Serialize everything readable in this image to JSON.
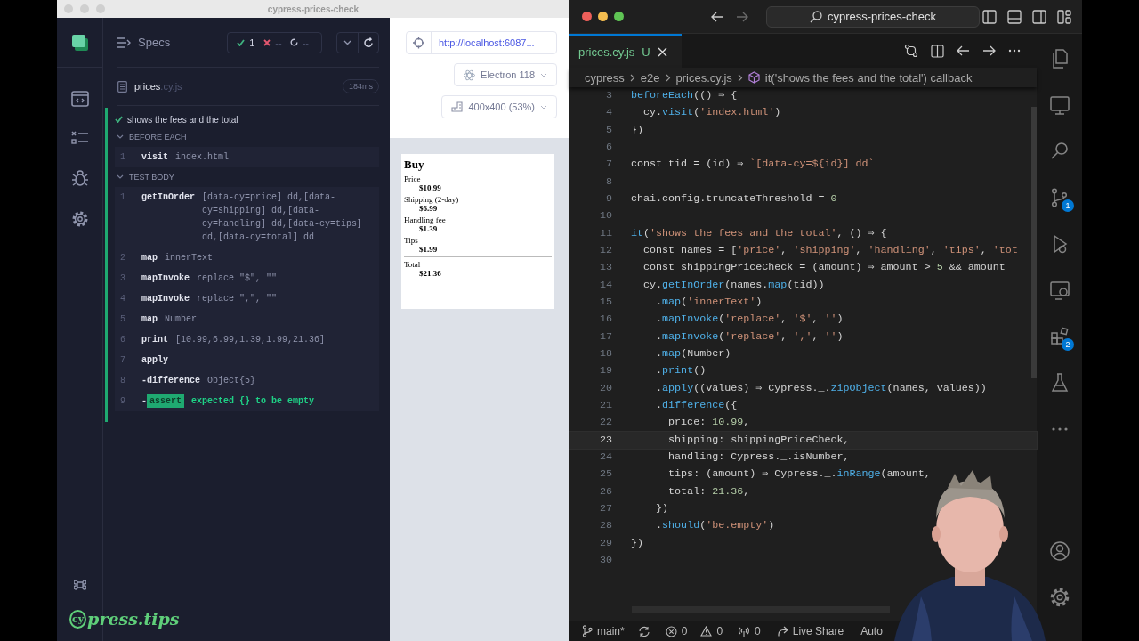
{
  "cypress_window": {
    "title": "cypress-prices-check"
  },
  "runner": {
    "header": {
      "title": "Specs",
      "passed": "1",
      "failed": "--",
      "pending": "--"
    },
    "spec": {
      "name": "prices",
      "extension": ".cy.js",
      "duration": "184ms"
    },
    "test": {
      "title": "shows the fees and the total",
      "passed": true
    },
    "hooks": [
      {
        "title": "BEFORE EACH",
        "expanded": true,
        "commands": [
          {
            "number": "1",
            "name": "visit",
            "message": "index.html",
            "kind": "parent"
          }
        ]
      },
      {
        "title": "TEST BODY",
        "expanded": true,
        "commands": [
          {
            "number": "1",
            "name": "getInOrder",
            "message": "[data-cy=price] dd,[data-cy=shipping] dd,[data-cy=handling] dd,[data-cy=tips] dd,[data-cy=total] dd",
            "kind": "parent"
          },
          {
            "number": "2",
            "name": "map",
            "message": "innerText",
            "kind": "parent"
          },
          {
            "number": "3",
            "name": "mapInvoke",
            "message": "replace \"$\", \"\"",
            "kind": "parent"
          },
          {
            "number": "4",
            "name": "mapInvoke",
            "message": "replace \",\", \"\"",
            "kind": "parent"
          },
          {
            "number": "5",
            "name": "map",
            "message": "Number",
            "kind": "parent"
          },
          {
            "number": "6",
            "name": "print",
            "message": "[10.99,6.99,1.39,1.99,21.36]",
            "kind": "parent"
          },
          {
            "number": "7",
            "name": "apply",
            "kind": "parent"
          },
          {
            "number": "8",
            "prefix": "-",
            "name": "difference",
            "message": "Object{5}",
            "kind": "child"
          },
          {
            "number": "9",
            "prefix": "-",
            "name": "assert",
            "message": "expected {} to be empty",
            "kind": "assert"
          }
        ]
      }
    ],
    "logo": {
      "mark": "cy",
      "text": "press.tips"
    }
  },
  "preview": {
    "url": "http://localhost:6087...",
    "browser": "Electron 118",
    "viewport": "400x400 (53%)",
    "page": {
      "heading": "Buy",
      "items": [
        {
          "label": "Price",
          "value": "$10.99"
        },
        {
          "label": "Shipping (2-day)",
          "value": "$6.99"
        },
        {
          "label": "Handling fee",
          "value": "$1.39"
        },
        {
          "label": "Tips",
          "value": "$1.99"
        }
      ],
      "total": {
        "label": "Total",
        "value": "$21.36"
      }
    }
  },
  "editor": {
    "title": "cypress-prices-check",
    "tab": {
      "label": "prices.cy.js",
      "status": "U",
      "selected": true
    },
    "breadcrumbs": [
      "cypress",
      "e2e",
      "prices.cy.js",
      "it('shows the fees and the total') callback"
    ],
    "lines": [
      {
        "number": "3",
        "text": "beforeEach(() ⇒ {",
        "current": false
      },
      {
        "number": "4",
        "text": "  cy.visit('index.html')",
        "current": false
      },
      {
        "number": "5",
        "text": "})",
        "current": false
      },
      {
        "number": "6",
        "current": false
      },
      {
        "number": "7",
        "text": "const tid = (id) ⇒ `[data-cy=${id}] dd`",
        "current": false
      },
      {
        "number": "8",
        "current": false
      },
      {
        "number": "9",
        "text": "chai.config.truncateThreshold = 0",
        "current": false
      },
      {
        "number": "10",
        "current": false
      },
      {
        "number": "11",
        "text": "it('shows the fees and the total', () ⇒ {",
        "current": false
      },
      {
        "number": "12",
        "text": "  const names = ['price', 'shipping', 'handling', 'tips', 'tot",
        "current": false
      },
      {
        "number": "13",
        "text": "  const shippingPriceCheck = (amount) ⇒ amount > 5 && amount",
        "current": false
      },
      {
        "number": "14",
        "text": "  cy.getInOrder(names.map(tid))",
        "current": false
      },
      {
        "number": "15",
        "text": "    .map('innerText')",
        "current": false
      },
      {
        "number": "16",
        "text": "    .mapInvoke('replace', '$', '')",
        "current": false
      },
      {
        "number": "17",
        "text": "    .mapInvoke('replace', ',', '')",
        "current": false
      },
      {
        "number": "18",
        "text": "    .map(Number)",
        "current": false
      },
      {
        "number": "19",
        "text": "    .print()",
        "current": false
      },
      {
        "number": "20",
        "text": "    .apply((values) ⇒ Cypress._.zipObject(names, values))",
        "current": false
      },
      {
        "number": "21",
        "text": "    .difference({",
        "current": false
      },
      {
        "number": "22",
        "text": "      price: 10.99,",
        "current": false
      },
      {
        "number": "23",
        "text": "      shipping: shippingPriceCheck,",
        "current": true
      },
      {
        "number": "24",
        "text": "      handling: Cypress._.isNumber,",
        "current": false
      },
      {
        "number": "25",
        "text": "      tips: (amount) ⇒ Cypress._.inRange(amount,",
        "current": false
      },
      {
        "number": "26",
        "text": "      total: 21.36,",
        "current": false
      },
      {
        "number": "27",
        "text": "    })",
        "current": false
      },
      {
        "number": "28",
        "text": "    .should('be.empty')",
        "current": false
      },
      {
        "number": "29",
        "text": "})",
        "current": false
      },
      {
        "number": "30",
        "current": false
      }
    ],
    "activity_badges": [
      "1",
      "2"
    ],
    "status_bar": {
      "branch": "main*",
      "errors": "0",
      "warnings": "0",
      "ports": "0",
      "live_share": "Live Share",
      "next": "Auto"
    }
  }
}
